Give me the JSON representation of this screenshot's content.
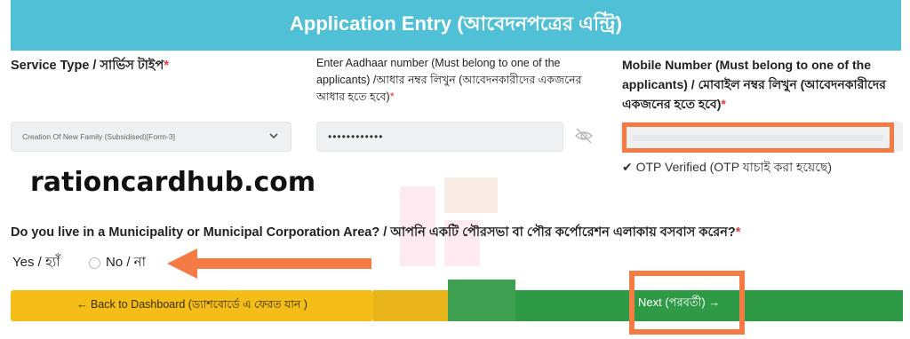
{
  "header": {
    "title": "Application Entry (আবেদনপত্রের এন্ট্রি)"
  },
  "fields": {
    "service_type": {
      "label": "Service Type / সার্ভিস টাইপ",
      "required_mark": "*",
      "selected_value": "Creation Of New Family (Subsidised)[Form-3]"
    },
    "aadhaar": {
      "label": "Enter Aadhaar number (Must belong to one of the applicants) /আধার নম্বর লিখুন (আবেদনকারীদের একজনের আধার হতে হবে)",
      "required_mark": "*",
      "value": "••••••••••••"
    },
    "mobile": {
      "label": "Mobile Number (Must belong to one of the applicants) / মোবাইল নম্বর লিখুন (আবেদনকারীদের একজনের হতে হবে)",
      "required_mark": "*",
      "otp_status": "✔ OTP Verified (OTP যাচাই করা হয়েছে)"
    }
  },
  "watermark": {
    "text": "rationcardhub.com"
  },
  "question": {
    "text": "Do you live in a Municipality or Municipal Corporation Area? / আপনি একটি পৌরসভা বা পৌর কর্পোরেশন এলাকায় বসবাস করেন?",
    "required_mark": "*",
    "options": [
      {
        "label": "Yes / হ্যাঁ"
      },
      {
        "label": "No / না"
      }
    ]
  },
  "buttons": {
    "back": "← Back to Dashboard (ড্যাশবোর্ডে এ ফেরত যান )",
    "next": "Next (পরবর্তী) →"
  },
  "colors": {
    "header_bg": "#4fc0d6",
    "back_button": "#f5bd18",
    "next_button": "#2f9a45",
    "highlight": "#f47b43",
    "required": "#e53935"
  },
  "icons": {
    "select_chevron": "chevron-down-icon",
    "password_toggle": "eye-off-icon",
    "annotation_arrow": "arrow-left-icon"
  }
}
